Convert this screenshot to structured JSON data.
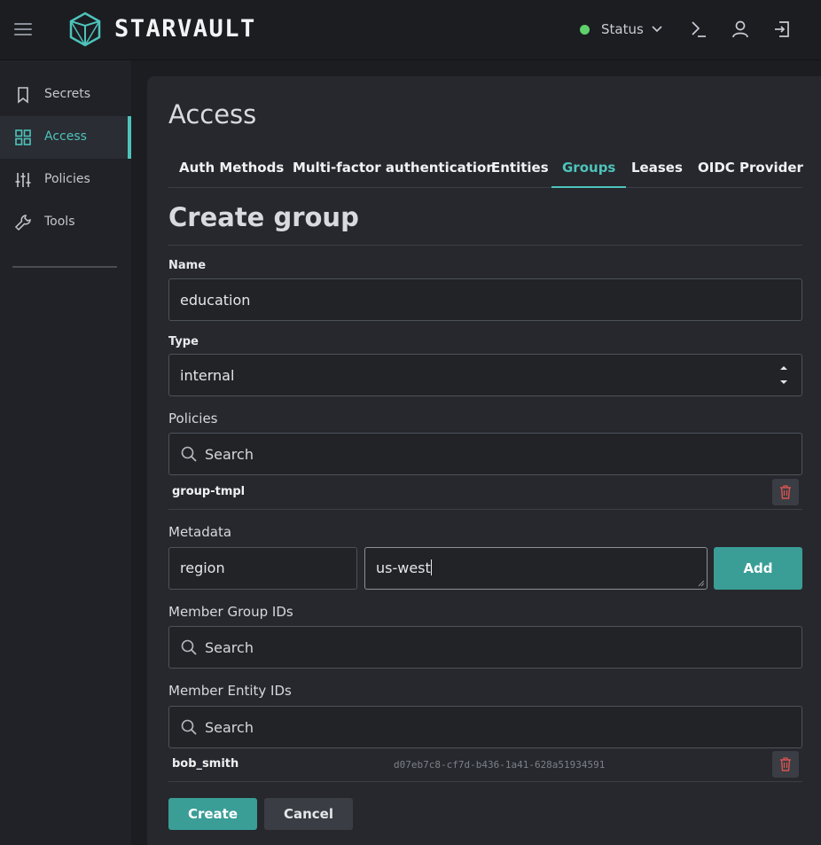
{
  "app": {
    "brand": "STARVAULT"
  },
  "topbar": {
    "status_label": "Status",
    "status_color": "#5fd16b",
    "icons": [
      "terminal-icon",
      "user-icon",
      "logout-icon"
    ]
  },
  "sidebar": {
    "items": [
      {
        "label": "Secrets",
        "icon": "bookmark-icon",
        "active": false
      },
      {
        "label": "Access",
        "icon": "grid-icon",
        "active": true
      },
      {
        "label": "Policies",
        "icon": "sliders-icon",
        "active": false
      },
      {
        "label": "Tools",
        "icon": "wrench-icon",
        "active": false
      }
    ]
  },
  "page": {
    "title": "Access",
    "tabs": [
      {
        "label": "Auth Methods",
        "active": false
      },
      {
        "label": "Multi-factor authentication",
        "active": false
      },
      {
        "label": "Entities",
        "active": false
      },
      {
        "label": "Groups",
        "active": true
      },
      {
        "label": "Leases",
        "active": false
      },
      {
        "label": "OIDC Provider",
        "active": false
      }
    ],
    "section_title": "Create group"
  },
  "form": {
    "name_label": "Name",
    "name_value": "education",
    "type_label": "Type",
    "type_value": "internal",
    "policies_label": "Policies",
    "policies_search_placeholder": "Search",
    "policies_selected": [
      "group-tmpl"
    ],
    "metadata_label": "Metadata",
    "metadata_key": "region",
    "metadata_value": "us-west",
    "metadata_add_label": "Add",
    "member_group_ids_label": "Member Group IDs",
    "member_group_ids_placeholder": "Search",
    "member_entity_ids_label": "Member Entity IDs",
    "member_entity_ids_placeholder": "Search",
    "member_entities": [
      {
        "name": "bob_smith",
        "id": "d07eb7c8-cf7d-b436-1a41-628a51934591"
      }
    ],
    "create_label": "Create",
    "cancel_label": "Cancel"
  },
  "colors": {
    "accent": "#4ec3bb",
    "primary_button": "#3a9e97",
    "danger": "#d9534f"
  }
}
